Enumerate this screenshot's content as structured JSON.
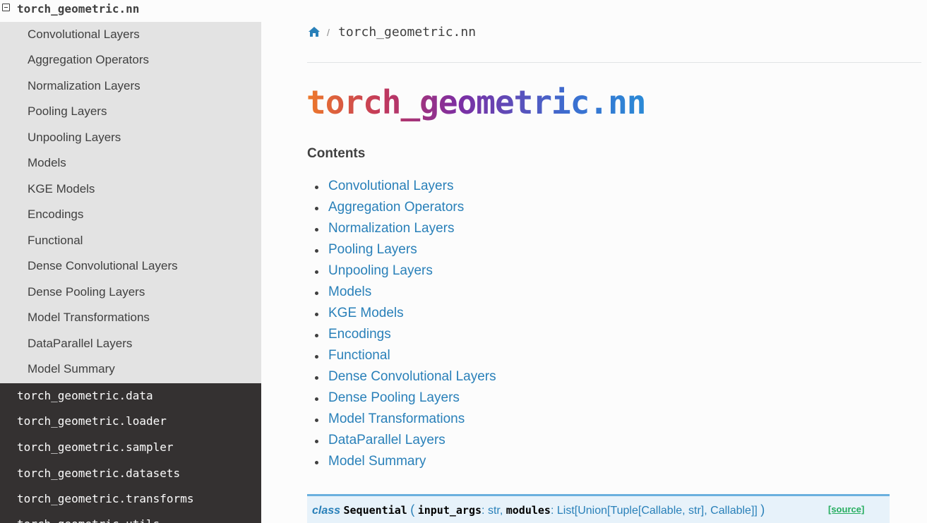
{
  "sidebar": {
    "current_section": "torch_geometric.nn",
    "sub_items": [
      "Convolutional Layers",
      "Aggregation Operators",
      "Normalization Layers",
      "Pooling Layers",
      "Unpooling Layers",
      "Models",
      "KGE Models",
      "Encodings",
      "Functional",
      "Dense Convolutional Layers",
      "Dense Pooling Layers",
      "Model Transformations",
      "DataParallel Layers",
      "Model Summary"
    ],
    "other_sections": [
      "torch_geometric.data",
      "torch_geometric.loader",
      "torch_geometric.sampler",
      "torch_geometric.datasets",
      "torch_geometric.transforms",
      "torch_geometric.utils"
    ]
  },
  "breadcrumb": {
    "home_icon": "home-icon",
    "separator": "/",
    "current": "torch_geometric.nn"
  },
  "page": {
    "title": "torch_geometric.nn",
    "contents_heading": "Contents",
    "toc": [
      "Convolutional Layers",
      "Aggregation Operators",
      "Normalization Layers",
      "Pooling Layers",
      "Unpooling Layers",
      "Models",
      "KGE Models",
      "Encodings",
      "Functional",
      "Dense Convolutional Layers",
      "Dense Pooling Layers",
      "Model Transformations",
      "DataParallel Layers",
      "Model Summary"
    ]
  },
  "signature": {
    "keyword": "class",
    "name": "Sequential",
    "open_paren": "(",
    "arg1_name": "input_args",
    "arg1_type": "str,",
    "arg2_name": "modules",
    "arg2_type": "List[Union[Tuple[Callable, str], Callable]]",
    "close_paren": ")",
    "source_label": "[source]"
  },
  "colors": {
    "sidebar_bg": "#343131",
    "sidebar_sub_bg": "#e3e3e3",
    "link": "#2980b9",
    "source": "#27ae60"
  }
}
